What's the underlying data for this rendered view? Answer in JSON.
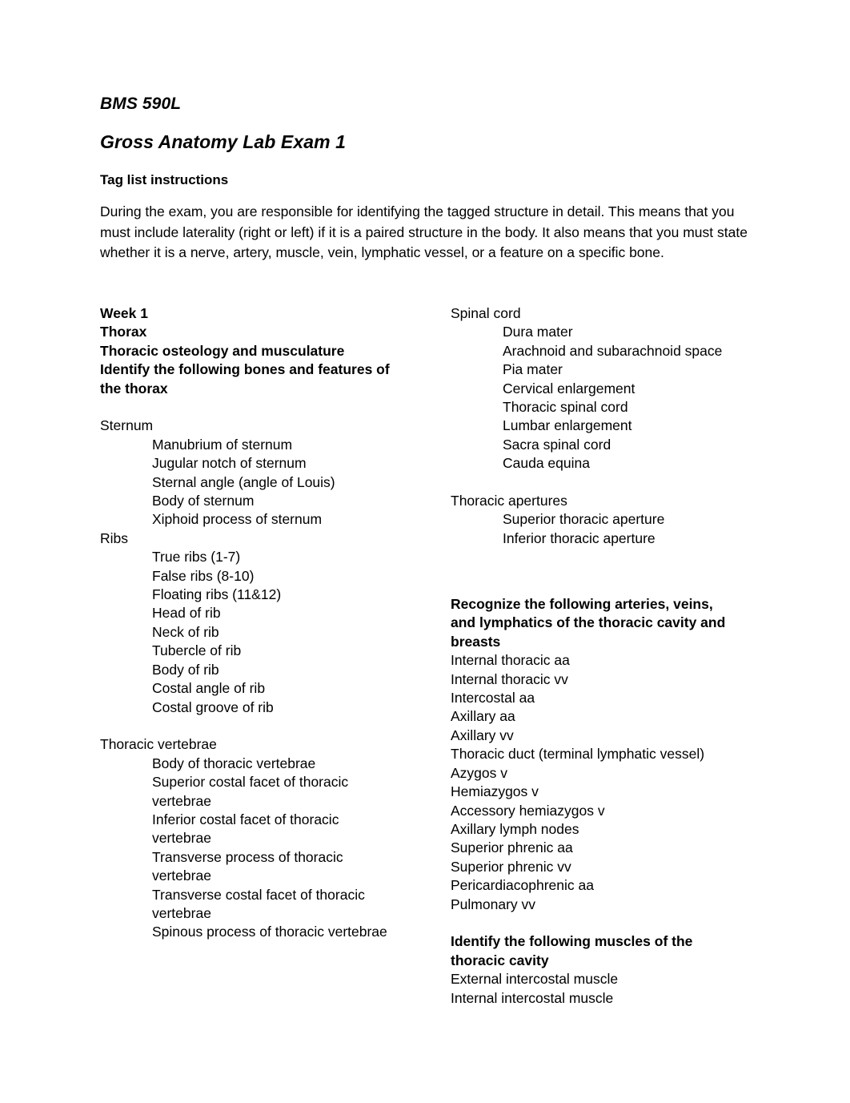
{
  "document": {
    "course_code": "BMS 590L",
    "title": "Gross Anatomy Lab Exam 1",
    "subtitle": "Tag list instructions",
    "intro_paragraph": "During the exam, you are responsible for identifying the tagged structure in detail. This means that you must include laterality (right or left) if it is a paired structure in the body. It also means that you must state whether it is a nerve, artery, muscle, vein, lymphatic vessel, or a feature on a specific bone."
  },
  "left_column": {
    "week_heading": "Week 1",
    "region_heading": "Thorax",
    "topic_heading": "Thoracic osteology and musculature",
    "task_heading_line1": "Identify the following bones and features of",
    "task_heading_line2": "the thorax",
    "groups": [
      {
        "name": "Sternum",
        "items": [
          "Manubrium of sternum",
          "Jugular notch of sternum",
          "Sternal angle (angle of Louis)",
          "Body of sternum",
          "Xiphoid process of sternum"
        ]
      },
      {
        "name": "Ribs",
        "items": [
          "True ribs (1-7)",
          "False ribs (8-10)",
          "Floating ribs (11&12)",
          "Head of rib",
          "Neck of rib",
          "Tubercle of rib",
          "Body of rib",
          "Costal angle of rib",
          "Costal groove of rib"
        ]
      },
      {
        "name": "Thoracic vertebrae",
        "items": [
          "Body of thoracic vertebrae",
          "Superior costal facet of thoracic vertebrae",
          "Inferior costal facet of thoracic vertebrae",
          "Transverse process of thoracic vertebrae",
          "Transverse costal facet of thoracic vertebrae",
          "Spinous process of thoracic vertebrae"
        ]
      }
    ]
  },
  "right_column": {
    "groups": [
      {
        "name": "Spinal cord",
        "items": [
          "Dura mater",
          "Arachnoid and subarachnoid space",
          "Pia mater",
          "Cervical enlargement",
          "Thoracic spinal cord",
          "Lumbar enlargement",
          "Sacra spinal cord",
          "Cauda equina"
        ]
      },
      {
        "name": "Thoracic apertures",
        "items": [
          "Superior thoracic aperture",
          "Inferior thoracic aperture"
        ]
      }
    ],
    "vessels_heading_line1": "Recognize the following arteries, veins,",
    "vessels_heading_line2": "and lymphatics of the thoracic cavity and",
    "vessels_heading_line3": "breasts",
    "vessels": [
      "Internal thoracic aa",
      "Internal thoracic vv",
      "Intercostal aa",
      "Axillary aa",
      "Axillary vv",
      "Thoracic duct (terminal lymphatic vessel)",
      "Azygos v",
      "Hemiazygos v",
      "Accessory hemiazygos v",
      "Axillary lymph nodes",
      "Superior phrenic aa",
      "Superior phrenic vv",
      "Pericardiacophrenic aa",
      "Pulmonary vv"
    ],
    "muscles_heading_line1": "Identify the following muscles of the",
    "muscles_heading_line2": "thoracic cavity",
    "muscles": [
      "External intercostal muscle",
      "Internal intercostal muscle"
    ]
  }
}
